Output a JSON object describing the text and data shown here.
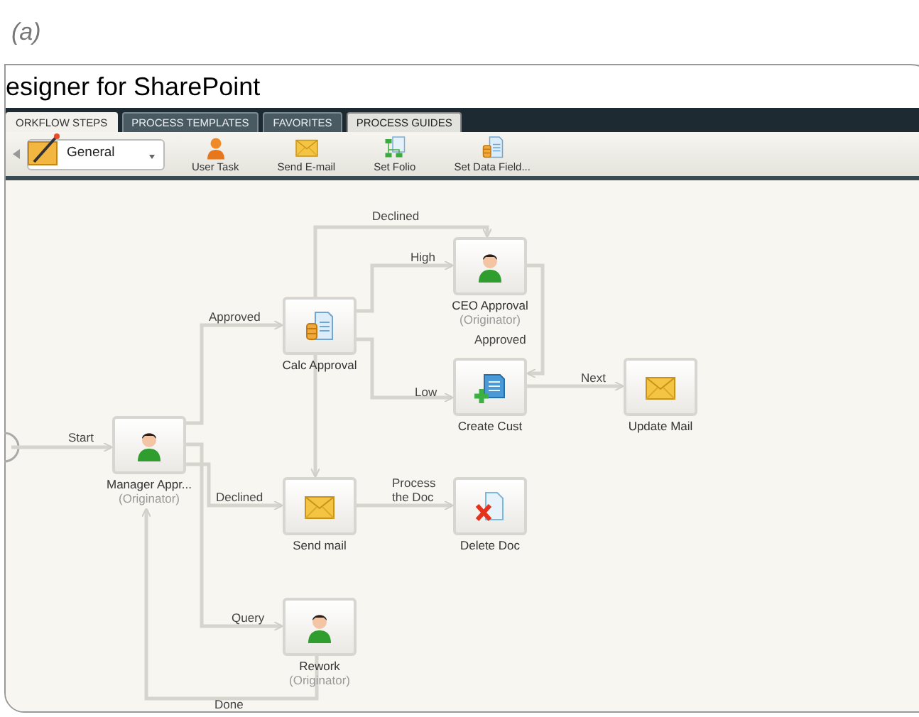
{
  "caption": "(a)",
  "window": {
    "title": "esigner for SharePoint"
  },
  "tabs": [
    {
      "label": "ORKFLOW STEPS",
      "selected": true,
      "hovered": false
    },
    {
      "label": "PROCESS TEMPLATES",
      "selected": false,
      "hovered": false
    },
    {
      "label": "FAVORITES",
      "selected": false,
      "hovered": false
    },
    {
      "label": "PROCESS GUIDES",
      "selected": false,
      "hovered": true
    }
  ],
  "toolbar": {
    "category": "General",
    "items": [
      {
        "label": "User Task",
        "kind": "person"
      },
      {
        "label": "Send E-mail",
        "kind": "envelope"
      },
      {
        "label": "Set Folio",
        "kind": "folio"
      },
      {
        "label": "Set Data Field...",
        "kind": "datafield"
      }
    ]
  },
  "nodes": [
    {
      "name": "Manager Appr...",
      "subtitle": "(Originator)",
      "kind": "person"
    },
    {
      "name": "Calc Approval",
      "kind": "calc"
    },
    {
      "name": "CEO Approval",
      "subtitle": "(Originator)",
      "kind": "person"
    },
    {
      "name": "Create Cust",
      "kind": "create"
    },
    {
      "name": "Update Mail",
      "kind": "envelope"
    },
    {
      "name": "Send mail",
      "kind": "envelope"
    },
    {
      "name": "Delete Doc",
      "kind": "delete"
    },
    {
      "name": "Rework",
      "subtitle": "(Originator)",
      "kind": "person"
    }
  ],
  "edges": [
    {
      "label": "Start"
    },
    {
      "label": "Approved"
    },
    {
      "label": "Declined"
    },
    {
      "label": "High"
    },
    {
      "label": "Low"
    },
    {
      "label": "Approved"
    },
    {
      "label": "Next"
    },
    {
      "label": "Declined"
    },
    {
      "label": "Process the Doc"
    },
    {
      "label": "Query"
    },
    {
      "label": "Done"
    }
  ]
}
